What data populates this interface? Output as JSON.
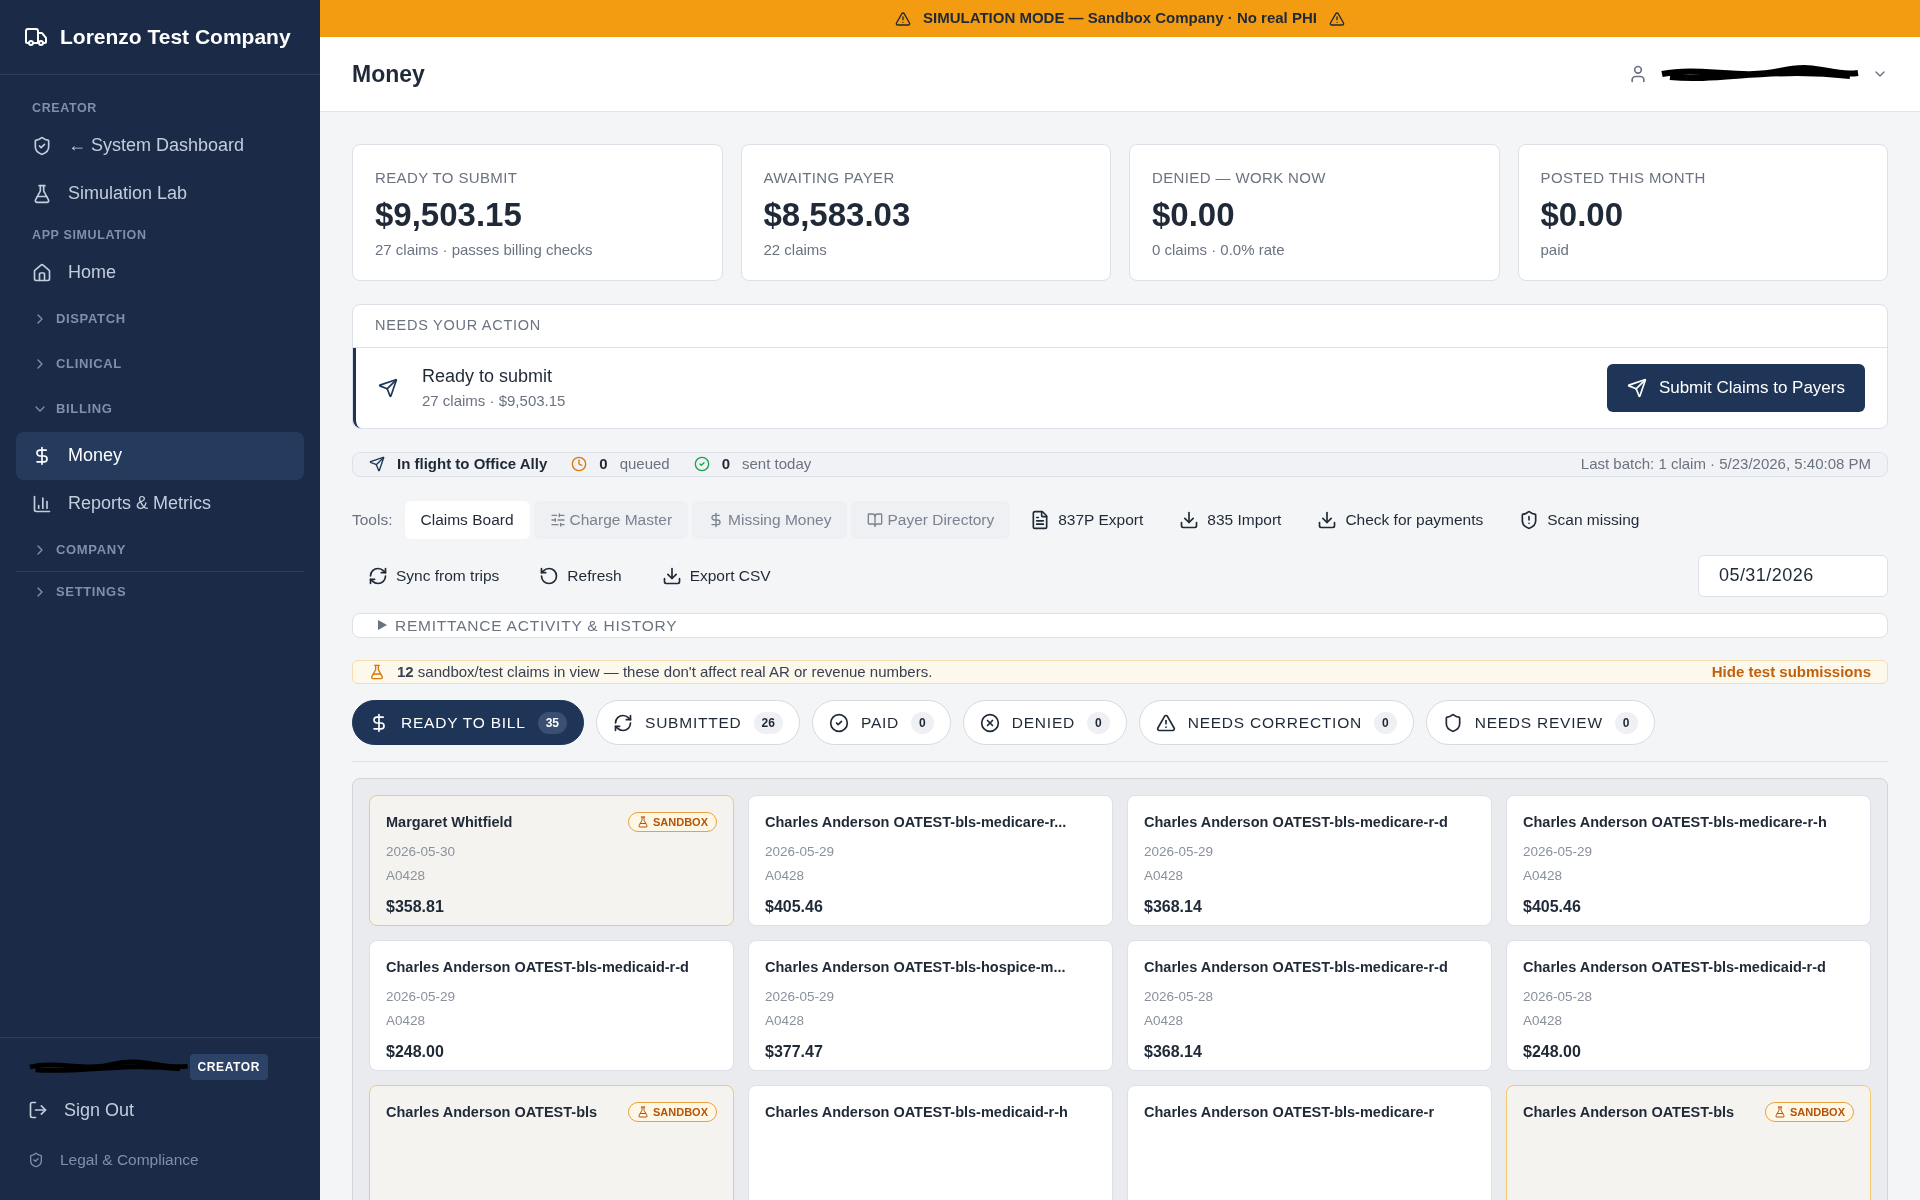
{
  "sidebar": {
    "brand": "Lorenzo Test Company",
    "items": [
      {
        "kind": "section",
        "label": "CREATOR"
      },
      {
        "kind": "link",
        "label": "← System Dashboard",
        "selected": false
      },
      {
        "kind": "link",
        "label": "Simulation Lab",
        "selected": false
      },
      {
        "kind": "section",
        "label": "APP SIMULATION"
      },
      {
        "kind": "link",
        "label": "Home",
        "selected": false
      },
      {
        "kind": "group",
        "label": "DISPATCH",
        "expanded": false
      },
      {
        "kind": "group",
        "label": "CLINICAL",
        "expanded": false
      },
      {
        "kind": "group",
        "label": "BILLING",
        "expanded": true
      },
      {
        "kind": "link",
        "label": "Money",
        "selected": true
      },
      {
        "kind": "link",
        "label": "Reports & Metrics",
        "selected": false
      },
      {
        "kind": "group",
        "label": "COMPANY",
        "expanded": false
      },
      {
        "kind": "divider"
      },
      {
        "kind": "group",
        "label": "SETTINGS",
        "expanded": false
      }
    ],
    "footer": {
      "role_badge": "CREATOR",
      "sign_out": "Sign Out",
      "legal": "Legal & Compliance"
    }
  },
  "banner": "SIMULATION MODE — Sandbox Company · No real PHI",
  "header": {
    "title": "Money"
  },
  "stats": [
    {
      "label": "READY TO SUBMIT",
      "value": "$9,503.15",
      "sub": "27 claims · passes billing checks"
    },
    {
      "label": "AWAITING PAYER",
      "value": "$8,583.03",
      "sub": "22 claims"
    },
    {
      "label": "DENIED — WORK NOW",
      "value": "$0.00",
      "sub": "0 claims · 0.0% rate"
    },
    {
      "label": "POSTED THIS MONTH",
      "value": "$0.00",
      "sub": "paid"
    }
  ],
  "action": {
    "heading": "NEEDS YOUR ACTION",
    "title": "Ready to submit",
    "sub": "27 claims · $9,503.15",
    "button": "Submit Claims to Payers"
  },
  "flight": {
    "label": "In flight to Office Ally",
    "queued_count": "0",
    "queued_label": "queued",
    "sent_count": "0",
    "sent_label": "sent today",
    "last_batch": "Last batch: 1 claim · 5/23/2026, 5:40:08 PM"
  },
  "tools": {
    "label": "Tools:",
    "items": [
      {
        "kind": "tab",
        "label": "Claims Board",
        "selected": true
      },
      {
        "kind": "tab",
        "label": "Charge Master",
        "selected": false
      },
      {
        "kind": "tab",
        "label": "Missing Money",
        "selected": false
      },
      {
        "kind": "tab",
        "label": "Payer Directory",
        "selected": false
      },
      {
        "kind": "action",
        "label": "837P Export"
      },
      {
        "kind": "action",
        "label": "835 Import"
      },
      {
        "kind": "action",
        "label": "Check for payments"
      },
      {
        "kind": "action",
        "label": "Scan missing"
      }
    ],
    "actions": [
      "Sync from trips",
      "Refresh",
      "Export CSV"
    ],
    "date": "05/31/2026"
  },
  "remittance": {
    "label": "REMITTANCE ACTIVITY & HISTORY",
    "expanded": false
  },
  "sandbox_notice": {
    "text": "**12** sandbox/test claims in view — these don't affect real AR or revenue numbers.",
    "link": "Hide test submissions"
  },
  "status_tabs": [
    {
      "label": "READY TO BILL",
      "count": "35",
      "selected": true
    },
    {
      "label": "SUBMITTED",
      "count": "26",
      "selected": false
    },
    {
      "label": "PAID",
      "count": "0",
      "selected": false
    },
    {
      "label": "DENIED",
      "count": "0",
      "selected": false
    },
    {
      "label": "NEEDS CORRECTION",
      "count": "0",
      "selected": false
    },
    {
      "label": "NEEDS REVIEW",
      "count": "0",
      "selected": false
    }
  ],
  "claims": [
    {
      "name": "Margaret Whitfield",
      "sandbox": true,
      "badge": "SANDBOX",
      "date": "2026-05-30",
      "code": "A0428",
      "amount": "$358.81"
    },
    {
      "name": "Charles Anderson OATEST-bls-medicare-r...",
      "sandbox": false,
      "date": "2026-05-29",
      "code": "A0428",
      "amount": "$405.46"
    },
    {
      "name": "Charles Anderson OATEST-bls-medicare-r-d",
      "sandbox": false,
      "date": "2026-05-29",
      "code": "A0428",
      "amount": "$368.14"
    },
    {
      "name": "Charles Anderson OATEST-bls-medicare-r-h",
      "sandbox": false,
      "date": "2026-05-29",
      "code": "A0428",
      "amount": "$405.46"
    },
    {
      "name": "Charles Anderson OATEST-bls-medicaid-r-d",
      "sandbox": false,
      "date": "2026-05-29",
      "code": "A0428",
      "amount": "$248.00"
    },
    {
      "name": "Charles Anderson OATEST-bls-hospice-m...",
      "sandbox": false,
      "date": "2026-05-29",
      "code": "A0428",
      "amount": "$377.47"
    },
    {
      "name": "Charles Anderson OATEST-bls-medicare-r-d",
      "sandbox": false,
      "date": "2026-05-28",
      "code": "A0428",
      "amount": "$368.14"
    },
    {
      "name": "Charles Anderson OATEST-bls-medicaid-r-d",
      "sandbox": false,
      "date": "2026-05-28",
      "code": "A0428",
      "amount": "$248.00"
    },
    {
      "name": "Charles Anderson OATEST-bls",
      "sandbox": true,
      "badge": "SANDBOX"
    },
    {
      "name": "Charles Anderson OATEST-bls-medicaid-r-h",
      "sandbox": false
    },
    {
      "name": "Charles Anderson OATEST-bls-medicare-r",
      "sandbox": false
    },
    {
      "name": "Charles Anderson OATEST-bls",
      "sandbox": true,
      "badge": "SANDBOX"
    }
  ]
}
